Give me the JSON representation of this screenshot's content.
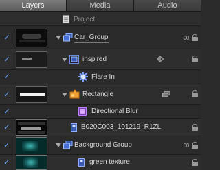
{
  "tabs": [
    {
      "label": "Layers",
      "active": true
    },
    {
      "label": "Media",
      "active": false
    },
    {
      "label": "Audio",
      "active": false
    }
  ],
  "rows": {
    "project": {
      "label": "Project"
    },
    "car_group": {
      "label": "Car_Group",
      "checked": true
    },
    "inspired": {
      "label": "inspired",
      "checked": true
    },
    "flare_in": {
      "label": "Flare In",
      "checked": true
    },
    "rectangle": {
      "label": "Rectangle",
      "checked": true
    },
    "directional_blur": {
      "label": "Directional Blur",
      "checked": true
    },
    "b020c003": {
      "label": "B020C003_101219_R1ZL",
      "checked": true
    },
    "background_group": {
      "label": "Background Group",
      "checked": true
    },
    "green_texture": {
      "label": "green texture",
      "checked": true
    }
  },
  "icons": {
    "checkbox": "checkmark-icon",
    "group": "layer-group-icon",
    "image": "film-clip-icon",
    "filter": "filter-icon",
    "shape": "shape-icon",
    "behavior": "behavior-gear-icon",
    "lock": "lock-icon",
    "link": "chain-link-icon"
  },
  "colors": {
    "check": "#6ea8ff",
    "group_icon": "#4a6fd6",
    "shape_orange": "#f0a030",
    "filter_purple": "#b060e0"
  }
}
